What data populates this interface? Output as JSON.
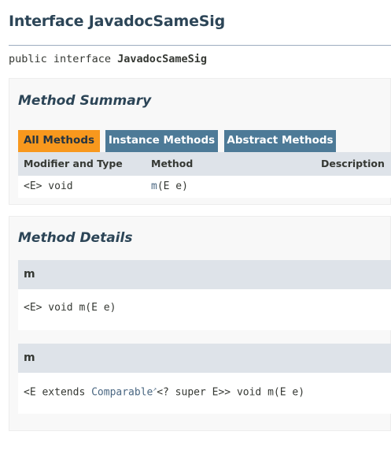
{
  "page": {
    "title": "Interface JavadocSameSig",
    "signature_prefix": "public interface ",
    "signature_name": "JavadocSameSig"
  },
  "method_summary": {
    "heading": "Method Summary",
    "tabs": [
      {
        "label": "All Methods",
        "active": true
      },
      {
        "label": "Instance Methods",
        "active": false
      },
      {
        "label": "Abstract Methods",
        "active": false
      }
    ],
    "columns": [
      "Modifier and Type",
      "Method",
      "Description"
    ],
    "rows": [
      {
        "modifier": "<E> void",
        "method_name": "m",
        "method_params": "(E e)",
        "description": ""
      }
    ]
  },
  "method_details": {
    "heading": "Method Details",
    "items": [
      {
        "name": "m",
        "sig_pre": "<E> void m(E e)",
        "sig_link": "",
        "sig_post": ""
      },
      {
        "name": "m",
        "sig_pre": "<E extends ",
        "sig_link": "Comparable",
        "sig_post": "<? super E>> void m(E e)"
      }
    ]
  },
  "icons": {
    "external_link": "external-link-icon"
  },
  "colors": {
    "title": "#2c4557",
    "active_tab": "#f8981d",
    "inactive_tab": "#4d7a97",
    "table_header": "#dee3e9",
    "link": "#4a6782"
  }
}
